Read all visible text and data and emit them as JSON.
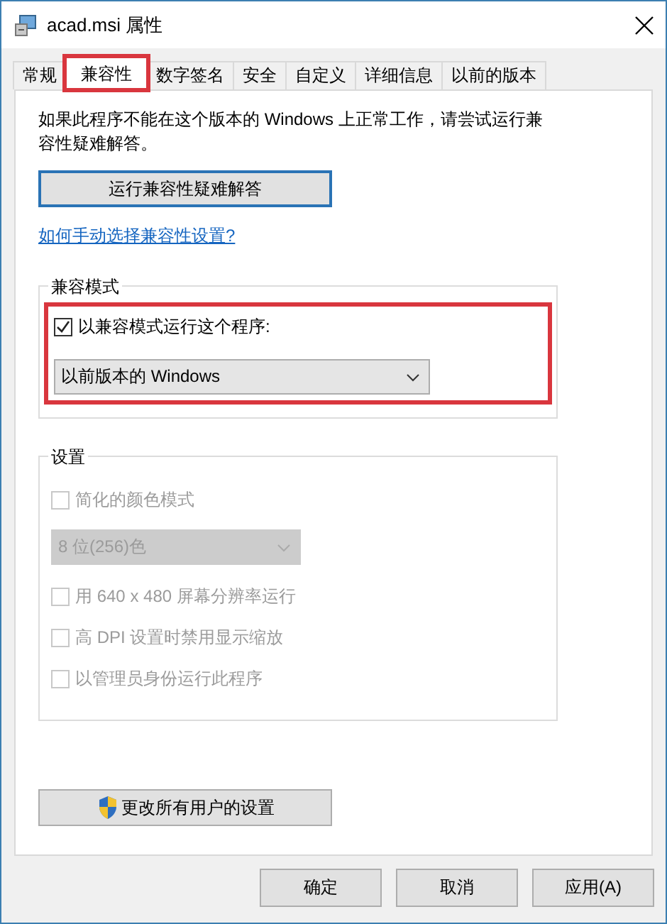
{
  "window": {
    "title": "acad.msi 属性"
  },
  "tabs": [
    {
      "label": "常规",
      "selected": false,
      "highlighted": false
    },
    {
      "label": "兼容性",
      "selected": true,
      "highlighted": true
    },
    {
      "label": "数字签名",
      "selected": false,
      "highlighted": false
    },
    {
      "label": "安全",
      "selected": false,
      "highlighted": false
    },
    {
      "label": "自定义",
      "selected": false,
      "highlighted": false
    },
    {
      "label": "详细信息",
      "selected": false,
      "highlighted": false
    },
    {
      "label": "以前的版本",
      "selected": false,
      "highlighted": false
    }
  ],
  "description": "如果此程序不能在这个版本的 Windows 上正常工作，请尝试运行兼容性疑难解答。",
  "troubleshoot_button": "运行兼容性疑难解答",
  "help_link": "如何手动选择兼容性设置?",
  "mode_group": {
    "title": "兼容模式",
    "highlighted": true,
    "items": [
      {
        "kind": "checkbox",
        "label": "以兼容模式运行这个程序:",
        "checked": true,
        "disabled": false
      },
      {
        "kind": "dropdown",
        "value": "以前版本的 Windows",
        "disabled": false
      }
    ]
  },
  "settings_group": {
    "title": "设置",
    "highlighted": false,
    "items": [
      {
        "kind": "checkbox",
        "label": "简化的颜色模式",
        "checked": false,
        "disabled": true
      },
      {
        "kind": "dropdown",
        "value": "8 位(256)色",
        "disabled": true
      },
      {
        "kind": "checkbox",
        "label": "用 640 x 480 屏幕分辨率运行",
        "checked": false,
        "disabled": true
      },
      {
        "kind": "checkbox",
        "label": "高 DPI 设置时禁用显示缩放",
        "checked": false,
        "disabled": true
      },
      {
        "kind": "checkbox",
        "label": "以管理员身份运行此程序",
        "checked": false,
        "disabled": true
      }
    ]
  },
  "all_users_button": "更改所有用户的设置",
  "buttons": [
    "确定",
    "取消",
    "应用(A)"
  ]
}
